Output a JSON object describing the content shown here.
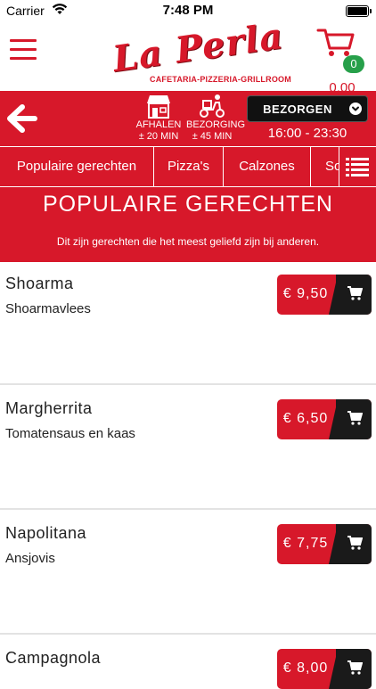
{
  "status_bar": {
    "carrier": "Carrier",
    "time": "7:48 PM"
  },
  "header": {
    "logo_text": "La Perla",
    "logo_tagline": "CAFETARIA-PIZZERIA-GRILLROOM",
    "cart_count": "0",
    "cart_total": "0.00"
  },
  "order_bar": {
    "pickup_label": "AFHALEN",
    "pickup_time": "± 20 MIN",
    "delivery_label": "BEZORGING",
    "delivery_time": "± 45 MIN",
    "selected_mode": "BEZORGEN",
    "hours": "16:00 - 23:30"
  },
  "tabs": [
    "Populaire gerechten",
    "Pizza's",
    "Calzones",
    "So"
  ],
  "section": {
    "title": "POPULAIRE GERECHTEN",
    "description": "Dit zijn gerechten die het meest geliefd zijn bij anderen."
  },
  "items": [
    {
      "name": "Shoarma",
      "description": "Shoarmavlees",
      "price": "€ 9,50"
    },
    {
      "name": "Margherrita",
      "description": "Tomatensaus en kaas",
      "price": "€ 6,50"
    },
    {
      "name": "Napolitana",
      "description": "Ansjovis",
      "price": "€ 7,75"
    },
    {
      "name": "Campagnola",
      "description": "",
      "price": "€ 8,00"
    }
  ],
  "colors": {
    "brand_red": "#d7182a",
    "dark": "#1a1a1a",
    "badge_green": "#27a04a"
  }
}
